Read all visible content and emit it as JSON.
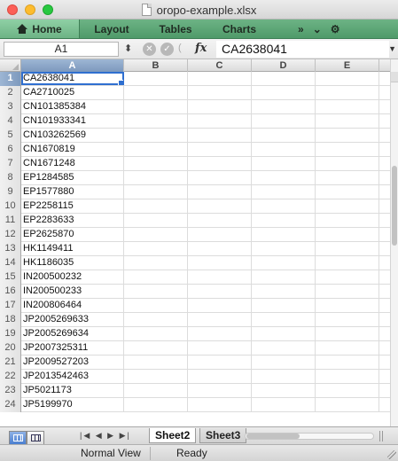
{
  "window": {
    "title": "oropo-example.xlsx"
  },
  "ribbon": {
    "tabs": [
      "Home",
      "Layout",
      "Tables",
      "Charts"
    ],
    "overflow_label": "»"
  },
  "formula_bar": {
    "name_box": "A1",
    "fx_label": "fx",
    "value": "CA2638041"
  },
  "grid": {
    "columns": [
      "A",
      "B",
      "C",
      "D",
      "E"
    ],
    "selected_column": "A",
    "active_cell": "A1",
    "row_numbers": [
      "1",
      "2",
      "3",
      "4",
      "5",
      "6",
      "7",
      "8",
      "9",
      "10",
      "11",
      "12",
      "13",
      "14",
      "15",
      "16",
      "17",
      "18",
      "19",
      "20",
      "21",
      "22",
      "23",
      "24"
    ],
    "column_a": [
      "CA2638041",
      "CA2710025",
      "CN101385384",
      "CN101933341",
      "CN103262569",
      "CN1670819",
      "CN1671248",
      "EP1284585",
      "EP1577880",
      "EP2258115",
      "EP2283633",
      "EP2625870",
      "HK1149411",
      "HK1186035",
      "IN200500232",
      "IN200500233",
      "IN200806464",
      "JP2005269633",
      "JP2005269634",
      "JP2007325311",
      "JP2009527203",
      "JP2013542463",
      "JP5021173",
      "JP5199970"
    ]
  },
  "sheets": {
    "tabs": [
      "Sheet2",
      "Sheet3"
    ],
    "active": "Sheet2"
  },
  "status": {
    "view": "Normal View",
    "state": "Ready"
  }
}
